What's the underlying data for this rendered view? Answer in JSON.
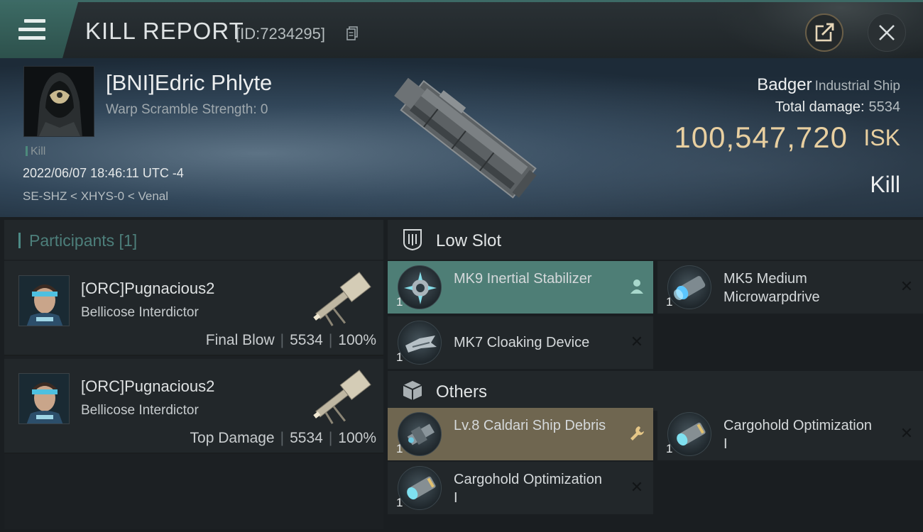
{
  "header": {
    "title": "KILL REPORT",
    "report_id": "[ID:7234295]"
  },
  "victim": {
    "name": "[BNI]Edric Phlyte",
    "warp_scramble": "Warp Scramble Strength: 0",
    "tag": "Kill",
    "datetime": "2022/06/07 18:46:11 UTC -4",
    "location": "SE-SHZ < XHYS-0 < Venal",
    "ship_name": "Badger",
    "ship_class": "Industrial Ship",
    "total_damage_label": "Total damage:",
    "total_damage_value": "5534",
    "isk_value": "100,547,720",
    "isk_unit": "ISK",
    "result": "Kill"
  },
  "participants": {
    "title": "Participants [1]",
    "rows": [
      {
        "name": "[ORC]Pugnacious2",
        "ship": "Bellicose Interdictor",
        "role": "Final Blow",
        "damage": "5534",
        "percent": "100%"
      },
      {
        "name": "[ORC]Pugnacious2",
        "ship": "Bellicose Interdictor",
        "role": "Top Damage",
        "damage": "5534",
        "percent": "100%"
      }
    ]
  },
  "fitting": {
    "low_slot": {
      "title": "Low Slot",
      "modules": [
        {
          "qty": "1",
          "name": "MK9 Inertial Stabilizer",
          "status": "pilot-icon"
        },
        {
          "qty": "1",
          "name": "MK5 Medium Microwarpdrive",
          "status": "close-icon"
        },
        {
          "qty": "1",
          "name": "MK7 Cloaking Device",
          "status": "close-icon"
        }
      ]
    },
    "others": {
      "title": "Others",
      "modules": [
        {
          "qty": "1",
          "name": "Lv.8 Caldari Ship Debris",
          "status": "wrench-icon"
        },
        {
          "qty": "1",
          "name": "Cargohold Optimization I",
          "status": "close-icon"
        },
        {
          "qty": "1",
          "name": "Cargohold Optimization I",
          "status": "close-icon"
        }
      ]
    }
  },
  "colors": {
    "accent_teal": "#4e7e76",
    "isk_gold": "#e8cfa0",
    "highlight_gold": "#6f6650"
  }
}
